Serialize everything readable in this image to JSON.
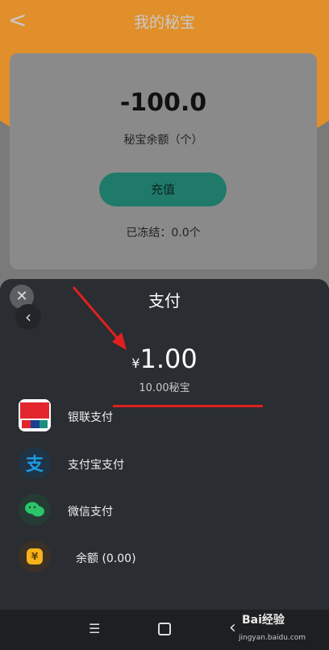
{
  "header": {
    "title": "我的秘宝",
    "back_glyph": "<"
  },
  "card": {
    "balance": "-100.0",
    "balance_label": "秘宝余额（个）",
    "recharge_label": "充值",
    "frozen_text": "已冻结：0.0个"
  },
  "sheet": {
    "title": "支付",
    "close_glyph": "✕",
    "back_glyph": "‹",
    "currency": "¥",
    "amount": "1.00",
    "amount_sub": "10.00秘宝"
  },
  "methods": [
    {
      "label": "银联支付",
      "icon": "unionpay-icon",
      "icon_text": "云闪付"
    },
    {
      "label": "支付宝支付",
      "icon": "alipay-icon",
      "icon_text": "支"
    },
    {
      "label": "微信支付",
      "icon": "wechat-pay-icon",
      "icon_text": ""
    },
    {
      "label": "余额 (0.00)",
      "icon": "balance-icon",
      "icon_text": "¥"
    }
  ],
  "navbar": {
    "menu_glyph": "☰",
    "back_glyph": "‹"
  },
  "watermark": {
    "line1": "Bai经验",
    "line2": "jingyan.baidu.com"
  },
  "colors": {
    "orange": "#e08f2a",
    "teal": "#1f7a6a",
    "sheet": "#2a2d31",
    "red": "#e02020"
  }
}
